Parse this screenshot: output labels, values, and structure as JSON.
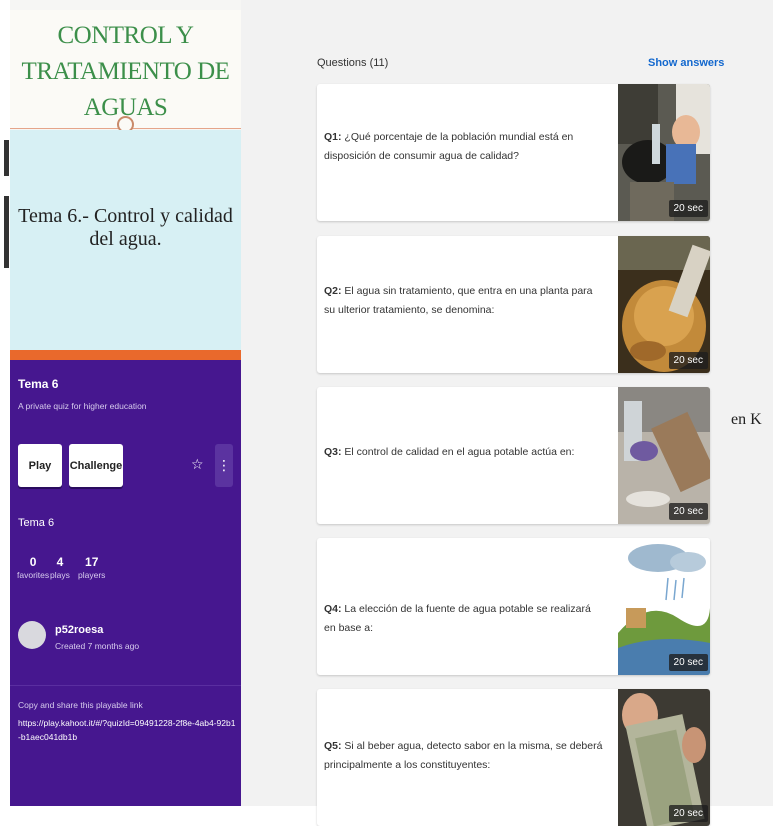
{
  "presentation": {
    "title_line1": "CONTROL Y",
    "title_line2": "TRATAMIENTO DE AGUAS",
    "subtitle": "Tema 6.- Control y calidad del agua."
  },
  "quiz": {
    "title": "Tema 6",
    "description": "A private quiz for higher education",
    "play_label": "Play",
    "challenge_label": "Challenge",
    "favorite_icon": "star-outline-icon",
    "more_icon": "more-vertical-icon",
    "title_repeat": "Tema 6",
    "stats": {
      "favorites_value": "0",
      "favorites_label": "favorites",
      "plays_value": "4",
      "plays_label": "plays",
      "players_value": "17",
      "players_label": "players"
    },
    "author": "p52roesa",
    "created": "Created 7 months ago",
    "share_label": "Copy and share this playable link",
    "share_link": "https://play.kahoot.it/#/?quizId=09491228-2f8e-4ab4-92b1-b1aec041db1b"
  },
  "questions_header": "Questions (11)",
  "show_answers_label": "Show answers",
  "questions": [
    {
      "num": "Q1:",
      "text": " ¿Qué porcentaje de la población mundial está en disposición de consumir agua de calidad?",
      "time": "20 sec"
    },
    {
      "num": "Q2:",
      "text": " El agua sin tratamiento, que entra en una planta para su ulterior tratamiento, se denomina:",
      "time": "20 sec"
    },
    {
      "num": "Q3:",
      "text": " El control de calidad en el agua potable actúa en:",
      "time": "20 sec"
    },
    {
      "num": "Q4:",
      "text": " La elección de la fuente de agua potable se realizará en base a:",
      "time": "20 sec"
    },
    {
      "num": "Q5:",
      "text": " Si al beber agua, detecto sabor en la misma, se deberá principalmente a los constituyentes:",
      "time": "20 sec"
    }
  ],
  "side_text": "en K",
  "colors": {
    "kahoot_purple": "#46178f",
    "title_green": "#3c8f4a",
    "accent_orange": "#e9692c",
    "link_blue": "#1368ce"
  }
}
